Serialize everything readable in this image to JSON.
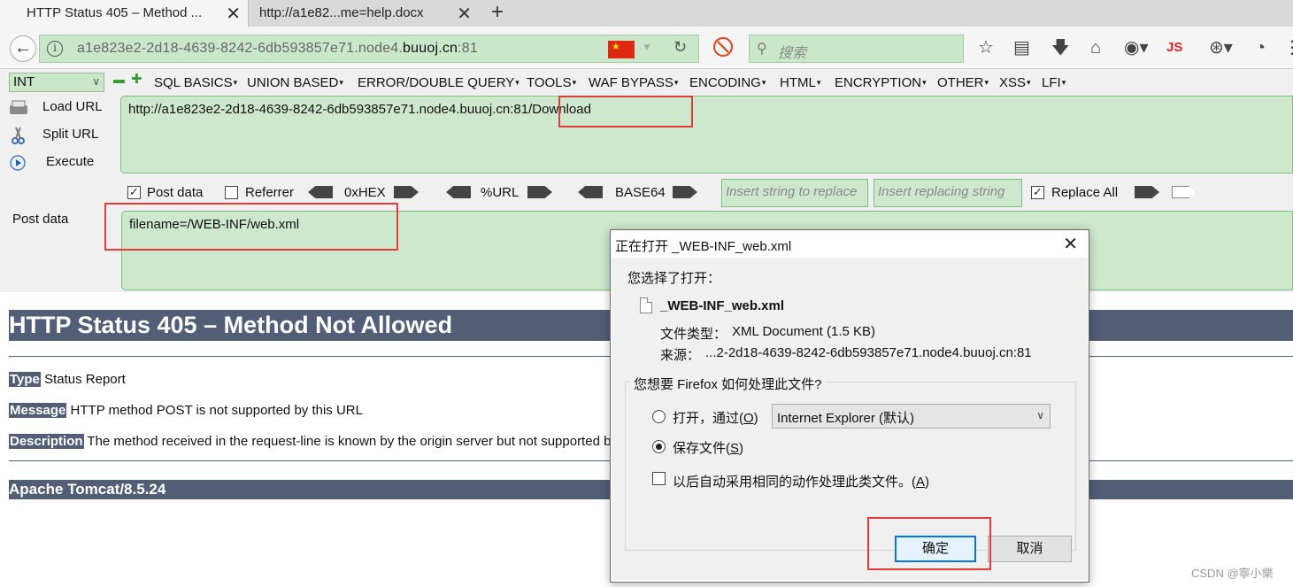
{
  "tabs": [
    {
      "label": "HTTP Status 405 – Method ...",
      "active": true
    },
    {
      "label": "http://a1e82...me=help.docx",
      "active": false
    }
  ],
  "navbar": {
    "url_prefix": "a1e823e2-2d18-4639-8242-6db593857e71.node4.",
    "url_domain": "buuoj.cn",
    "url_suffix": ":81",
    "search_placeholder": "搜索",
    "js_label": "JS"
  },
  "hackbar": {
    "type_select": "INT",
    "menus": [
      "SQL BASICS",
      "UNION BASED",
      "ERROR/DOUBLE QUERY",
      "TOOLS",
      "WAF BYPASS",
      "ENCODING",
      "HTML",
      "ENCRYPTION",
      "OTHER",
      "XSS",
      "LFI"
    ],
    "load_url_label": "Load URL",
    "split_url_label": "Split URL",
    "execute_label": "Execute",
    "url_value": "http://a1e823e2-2d18-4639-8242-6db593857e71.node4.buuoj.cn:81/Download",
    "post_data_chk_label": "Post data",
    "referrer_chk_label": "Referrer",
    "hex_label": "0xHEX",
    "url_enc_label": "%URL",
    "base64_label": "BASE64",
    "insert_replace_placeholder": "Insert string to replace",
    "insert_replacing_placeholder": "Insert replacing string",
    "replace_all_label": "Replace All",
    "post_data_label": "Post data",
    "post_data_value": "filename=/WEB-INF/web.xml"
  },
  "page": {
    "heading": "HTTP Status 405 – Method Not Allowed",
    "type_tag": "Type",
    "type_value": "Status Report",
    "message_tag": "Message",
    "message_value": "HTTP method POST is not supported by this URL",
    "description_tag": "Description",
    "description_value": "The method received in the request-line is known by the origin server but not supported by",
    "footer": "Apache Tomcat/8.5.24"
  },
  "dialog": {
    "title": "正在打开 _WEB-INF_web.xml",
    "chosen_label": "您选择了打开：",
    "filename": "_WEB-INF_web.xml",
    "filetype_label": "文件类型：",
    "filetype_value": "XML Document (1.5 KB)",
    "source_label": "来源：",
    "source_value": "...2-2d18-4639-8242-6db593857e71.node4.buuoj.cn:81",
    "question": "您想要 Firefox 如何处理此文件?",
    "open_with_label": "打开，通过(",
    "open_with_key": "O",
    "open_with_app": "Internet Explorer (默认)",
    "save_label": "保存文件(",
    "save_key": "S",
    "auto_label": "以后自动采用相同的动作处理此类文件。(",
    "auto_key": "A",
    "ok_label": "确定",
    "cancel_label": "取消"
  },
  "watermark": "CSDN @寧小樂",
  "colors": {
    "tomcat_bar": "#525d76",
    "hackbar_field": "#cde8cd",
    "highlight_box": "#e23c3c"
  }
}
